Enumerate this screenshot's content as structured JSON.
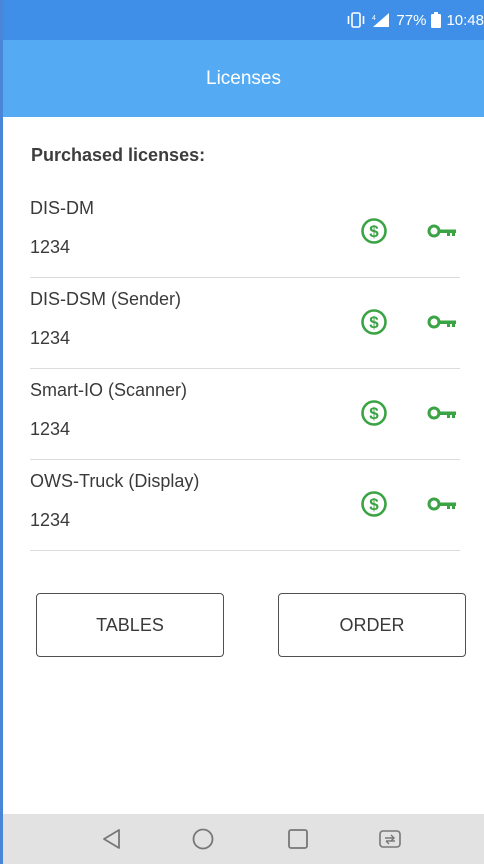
{
  "status_bar": {
    "battery": "77%",
    "time": "10:48"
  },
  "app_bar": {
    "title": "Licenses"
  },
  "section": {
    "title": "Purchased licenses:"
  },
  "licenses": [
    {
      "name": "DIS-DM",
      "value": "1234"
    },
    {
      "name": "DIS-DSM (Sender)",
      "value": "1234"
    },
    {
      "name": "Smart-IO (Scanner)",
      "value": "1234"
    },
    {
      "name": "OWS-Truck (Display)",
      "value": "1234"
    }
  ],
  "buttons": {
    "tables": "TABLES",
    "order": "ORDER"
  },
  "icons": {
    "buy": "dollar-circle-icon",
    "license_key": "key-icon",
    "nav_back": "back-triangle-icon",
    "nav_home": "home-circle-icon",
    "nav_recents": "recents-square-icon",
    "nav_switch": "switch-apps-icon"
  },
  "colors": {
    "status_bar": "#3f8fe8",
    "app_bar": "#55abf3",
    "icon_green": "#3aa344",
    "nav_bar": "#e2e2e2"
  }
}
